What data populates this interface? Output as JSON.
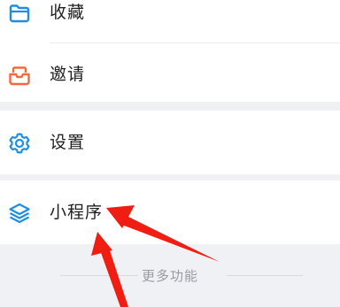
{
  "menu": {
    "group1": [
      {
        "label": "收藏",
        "icon": "folder-icon",
        "color": "#1e8ee0"
      },
      {
        "label": "邀请",
        "icon": "invite-inbox-icon",
        "color": "#f06a3b"
      }
    ],
    "group2": [
      {
        "label": "设置",
        "icon": "gear-icon",
        "color": "#1e8ee0"
      }
    ],
    "group3": [
      {
        "label": "小程序",
        "icon": "layers-icon",
        "color": "#1e8ee0"
      }
    ]
  },
  "more": {
    "label": "更多功能"
  },
  "annotation": {
    "arrow_color": "#f01d12"
  }
}
